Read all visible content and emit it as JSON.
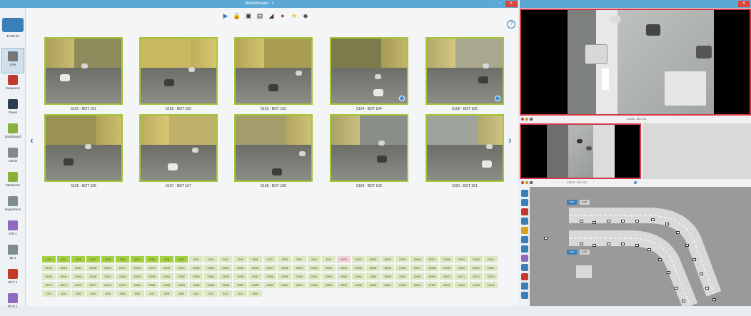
{
  "app": {
    "title": "MediaManager - 1",
    "window_controls": {
      "minimize": "-",
      "maximize": "▫",
      "close": "✕"
    }
  },
  "sidebar": {
    "time": "17:02:42",
    "items": [
      {
        "label": "Live",
        "icon": "live-camera-icon",
        "color": "#777777"
      },
      {
        "label": "Sequence",
        "icon": "sequence-icon",
        "color": "#c0392b"
      },
      {
        "label": "Panel",
        "icon": "panel-icon",
        "color": "#2c3e50"
      },
      {
        "label": "Dashboard",
        "icon": "dashboard-icon",
        "color": "#8bb03a"
      },
      {
        "label": "Admin",
        "icon": "admin-icon",
        "color": "#888888"
      },
      {
        "label": "Measures",
        "icon": "measures-icon",
        "color": "#8bb03a"
      },
      {
        "label": "Equipment",
        "icon": "equipment-icon",
        "color": "#7f8c8d"
      },
      {
        "label": "CIN 1",
        "icon": "cin-icon",
        "color": "#8e6bbf"
      },
      {
        "label": "BL 1",
        "icon": "bl-icon",
        "color": "#7f8c8d"
      },
      {
        "label": "BCT 1",
        "icon": "bct-icon",
        "color": "#c0392b"
      },
      {
        "label": "RCG 1",
        "icon": "rcg-icon",
        "color": "#8e6bbf"
      }
    ]
  },
  "toolbar": {
    "items": [
      {
        "icon": "play-icon",
        "glyph": "▶",
        "color": "#3a7fb8"
      },
      {
        "icon": "lock-icon",
        "glyph": "🔒",
        "color": "#333"
      },
      {
        "icon": "lock-copy-icon",
        "glyph": "▣",
        "color": "#333"
      },
      {
        "icon": "lock-paste-icon",
        "glyph": "▤",
        "color": "#333"
      },
      {
        "icon": "camera-move-icon",
        "glyph": "◢",
        "color": "#333"
      },
      {
        "icon": "alarm-icon",
        "glyph": "●",
        "color": "#c0392b"
      },
      {
        "icon": "favorite-star-icon",
        "glyph": "★",
        "color": "#f1c40f"
      },
      {
        "icon": "bell-icon",
        "glyph": "◆",
        "color": "#555"
      }
    ],
    "help": "?"
  },
  "cameras": [
    {
      "label": "5101 - BOT 101"
    },
    {
      "label": "5102 - BOT 102"
    },
    {
      "label": "5103 - BOT 103"
    },
    {
      "label": "5104 - BOT 104"
    },
    {
      "label": "5105 - BOT 105"
    },
    {
      "label": "5106 - BOT 106"
    },
    {
      "label": "5107 - BOT 107"
    },
    {
      "label": "5108 - BOT 108"
    },
    {
      "label": "5109 - BOT 109"
    },
    {
      "label": "5201 - BOT 201"
    }
  ],
  "nav": {
    "prev": "‹",
    "next": "›"
  },
  "camera_table": {
    "colors": {
      "active": "#a4d13f",
      "inactive": "#dce9c0",
      "alert": "#f5d0d5"
    },
    "rows": [
      [
        "5101",
        "5102",
        "5103",
        "5104",
        "5105",
        "5106",
        "5107",
        "5108",
        "5109",
        "5201",
        "5202",
        "5203",
        "5204",
        "5205",
        "5206",
        "5207",
        "5208",
        "5209",
        "5210",
        "5402",
        "23001",
        "23002",
        "23003",
        "23004",
        "23005",
        "23006",
        "23007",
        "23008",
        "23009",
        "23010",
        "23011"
      ],
      [
        "23012",
        "23013",
        "23014",
        "23015",
        "23016",
        "23017",
        "23018",
        "23019",
        "23020",
        "23021",
        "23022",
        "23023",
        "23024",
        "23025",
        "23026",
        "23027",
        "23028",
        "23029",
        "23030",
        "23031",
        "23032",
        "23033",
        "23034",
        "23035",
        "23036",
        "23037",
        "23038",
        "23039",
        "23040",
        "23041",
        "23042"
      ],
      [
        "23043",
        "23044",
        "23045",
        "23046",
        "23047",
        "23048",
        "23049",
        "23050",
        "23051",
        "23052",
        "23053",
        "23054",
        "23055",
        "23056",
        "23057",
        "23058",
        "23059",
        "23060",
        "23061",
        "23062",
        "23063",
        "23064",
        "23065",
        "23066",
        "23067",
        "23068",
        "23069",
        "23070",
        "23071",
        "23072",
        "23073"
      ],
      [
        "23074",
        "23075",
        "23076",
        "23077",
        "23078",
        "23079",
        "23080",
        "23081",
        "23082",
        "23083",
        "23084",
        "23085",
        "23086",
        "23087",
        "23088",
        "23089",
        "23090",
        "23091",
        "23092",
        "23093",
        "23094",
        "23095",
        "23096",
        "23097",
        "23098",
        "23099",
        "23100",
        "23101",
        "23102",
        "23103",
        "23104"
      ],
      [
        "3101",
        "3201",
        "3202",
        "3203",
        "3204",
        "3205",
        "3206",
        "3207",
        "3208",
        "3209",
        "3210",
        "3211",
        "3212",
        "3213",
        "3300"
      ]
    ]
  },
  "right": {
    "main_video_caption": "23211 - BG 211",
    "small_video_caption": "23212 - BG 212",
    "map_buttons": [
      "5201",
      "5202",
      "5203",
      "5204"
    ]
  }
}
